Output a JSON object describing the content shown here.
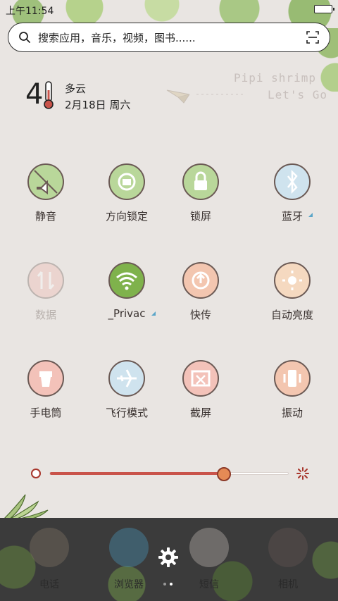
{
  "status_bar": {
    "time": "上午11:54"
  },
  "search": {
    "placeholder": "搜索应用，音乐，视频，图书......"
  },
  "weather": {
    "temperature": "4",
    "condition": "多云",
    "date": "2月18日 周六"
  },
  "brand": {
    "line1": "Pipi shrimp",
    "line2": "Let's Go"
  },
  "toggles": [
    {
      "label": "静音",
      "icon": "mute-icon",
      "color": "#b9d79a",
      "enabled": true
    },
    {
      "label": "方向锁定",
      "icon": "rotation-lock-icon",
      "color": "#b9d79a",
      "enabled": true
    },
    {
      "label": "锁屏",
      "icon": "lock-icon",
      "color": "#b9d79a",
      "enabled": true
    },
    {
      "label": "蓝牙",
      "icon": "bluetooth-icon",
      "color": "#cfe3ee",
      "enabled": true
    },
    {
      "label": "数据",
      "icon": "data-icon",
      "color": "#f1b7ad",
      "enabled": false
    },
    {
      "label": "_Privac",
      "icon": "wifi-icon",
      "color": "#7fb24c",
      "enabled": true
    },
    {
      "label": "快传",
      "icon": "share-icon",
      "color": "#f3c6b0",
      "enabled": true
    },
    {
      "label": "自动亮度",
      "icon": "brightness-icon",
      "color": "#f5d9c0",
      "enabled": true
    },
    {
      "label": "手电筒",
      "icon": "flashlight-icon",
      "color": "#f3c2b9",
      "enabled": true
    },
    {
      "label": "飞行模式",
      "icon": "airplane-icon",
      "color": "#cfe3ee",
      "enabled": true
    },
    {
      "label": "截屏",
      "icon": "screenshot-icon",
      "color": "#f3c2b9",
      "enabled": true
    },
    {
      "label": "振动",
      "icon": "vibrate-icon",
      "color": "#f3c6b0",
      "enabled": true
    }
  ],
  "brightness": {
    "level": 0.73,
    "min_icon": "brightness-low-icon",
    "max_icon": "brightness-high-icon"
  },
  "dock": {
    "apps": [
      {
        "label": "电话",
        "icon": "phone-icon"
      },
      {
        "label": "浏览器",
        "icon": "browser-icon"
      },
      {
        "label": "短信",
        "icon": "sms-icon"
      },
      {
        "label": "相机",
        "icon": "camera-icon"
      }
    ],
    "settings_icon": "gear-icon",
    "page_count": 2,
    "active_page": 1
  },
  "colors": {
    "background": "#e9e5e2",
    "slider_fill": "#c9534a",
    "slider_thumb": "#e58a55",
    "wifi_active": "#7fb24c"
  }
}
